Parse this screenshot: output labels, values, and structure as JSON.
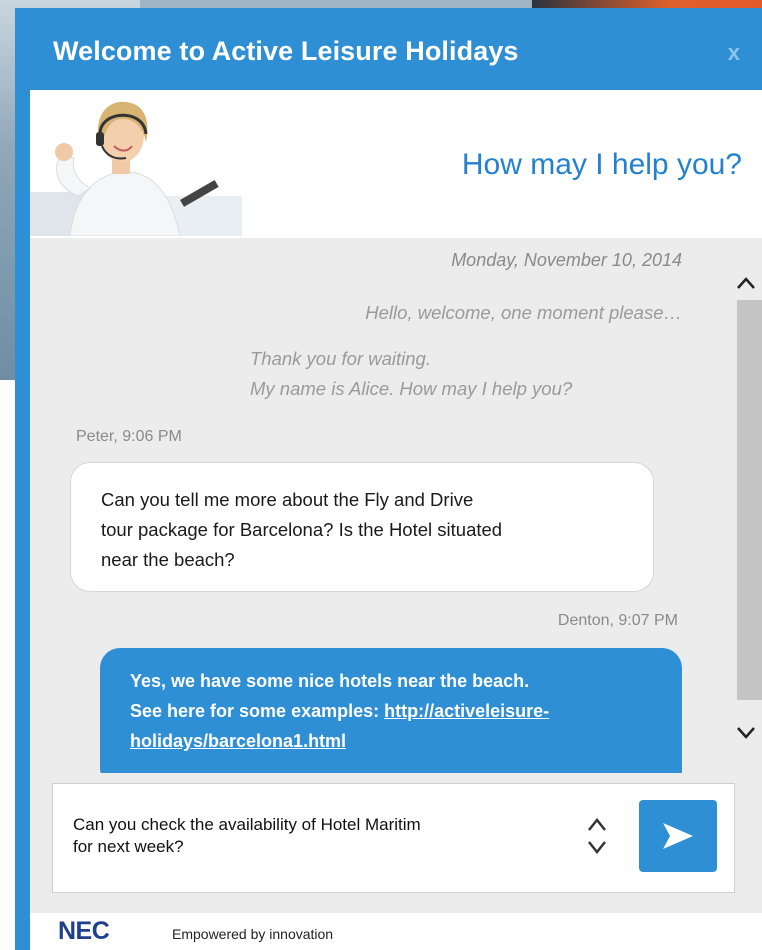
{
  "window": {
    "title": "Welcome to Active Leisure Holidays",
    "close_label": "x"
  },
  "header": {
    "help_text": "How may I help you?"
  },
  "chat": {
    "date": "Monday, November 10, 2014",
    "system_messages": [
      "Hello, welcome, one moment please…",
      "Thank you for waiting.",
      "My name is Alice. How may I help you?"
    ],
    "messages": [
      {
        "sender": "Peter, 9:06 PM",
        "lines": [
          "Can you tell me more about the Fly and Drive",
          "tour package for Barcelona? Is the Hotel situated",
          "near the beach?"
        ]
      },
      {
        "sender": "Denton, 9:07 PM",
        "lines": [
          "Yes, we have some nice hotels near the beach.",
          "See here for some examples: "
        ],
        "link_part1": "http://activeleisure-",
        "link_part2": "holidays/barcelona1.html"
      }
    ]
  },
  "input": {
    "text_line1": "Can you check the availability of Hotel Maritim",
    "text_line2": "for next week?"
  },
  "footer": {
    "brand": "NEC",
    "tagline": "Empowered by innovation"
  },
  "colors": {
    "primary": "#2e8fd5",
    "help_text": "#2381cf",
    "chat_bg": "#ececec",
    "brand": "#1e3f8c"
  }
}
